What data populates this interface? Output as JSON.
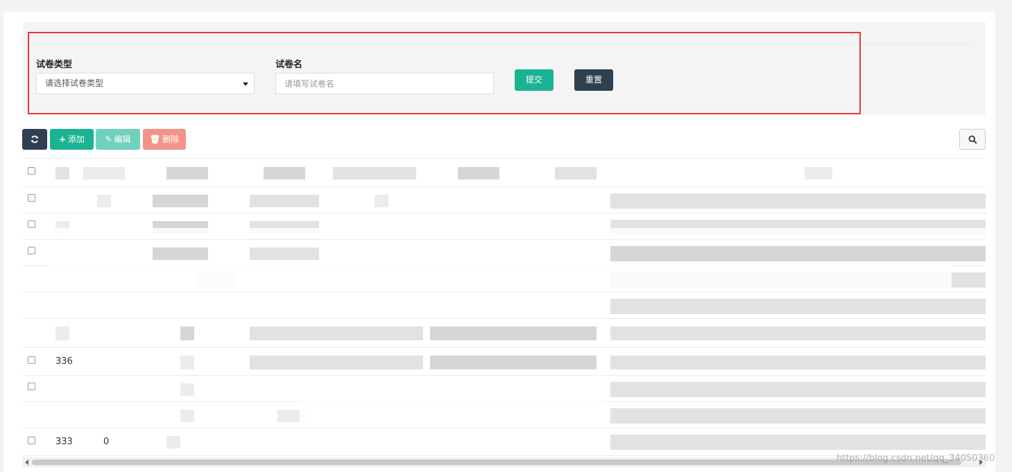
{
  "search": {
    "paper_type_label": "试卷类型",
    "paper_type_placeholder": "请选择试卷类型",
    "paper_name_label": "试卷名",
    "paper_name_placeholder": "请填写试卷名",
    "submit_label": "提交",
    "reset_label": "重置"
  },
  "toolbar": {
    "refresh_icon": "refresh-icon",
    "add_label": "添加",
    "edit_label": "编辑",
    "delete_label": "删除",
    "search_icon": "search-icon"
  },
  "table": {
    "rows": [
      {
        "id": "",
        "type": ""
      },
      {
        "id": "",
        "type": ""
      },
      {
        "id": "",
        "type": ""
      },
      {
        "id": "",
        "type": ""
      },
      {
        "id": "",
        "type": ""
      },
      {
        "id": "",
        "type": ""
      },
      {
        "id": "336",
        "type": ""
      },
      {
        "id": "",
        "type": ""
      },
      {
        "id": "",
        "type": ""
      },
      {
        "id": "333",
        "type": "0"
      }
    ]
  },
  "watermark": "https://blog.csdn.net/qq_34050360",
  "colors": {
    "primary": "#1ab394",
    "dark": "#2f4050",
    "danger": "#f3948b",
    "highlight_border": "#e53935"
  }
}
